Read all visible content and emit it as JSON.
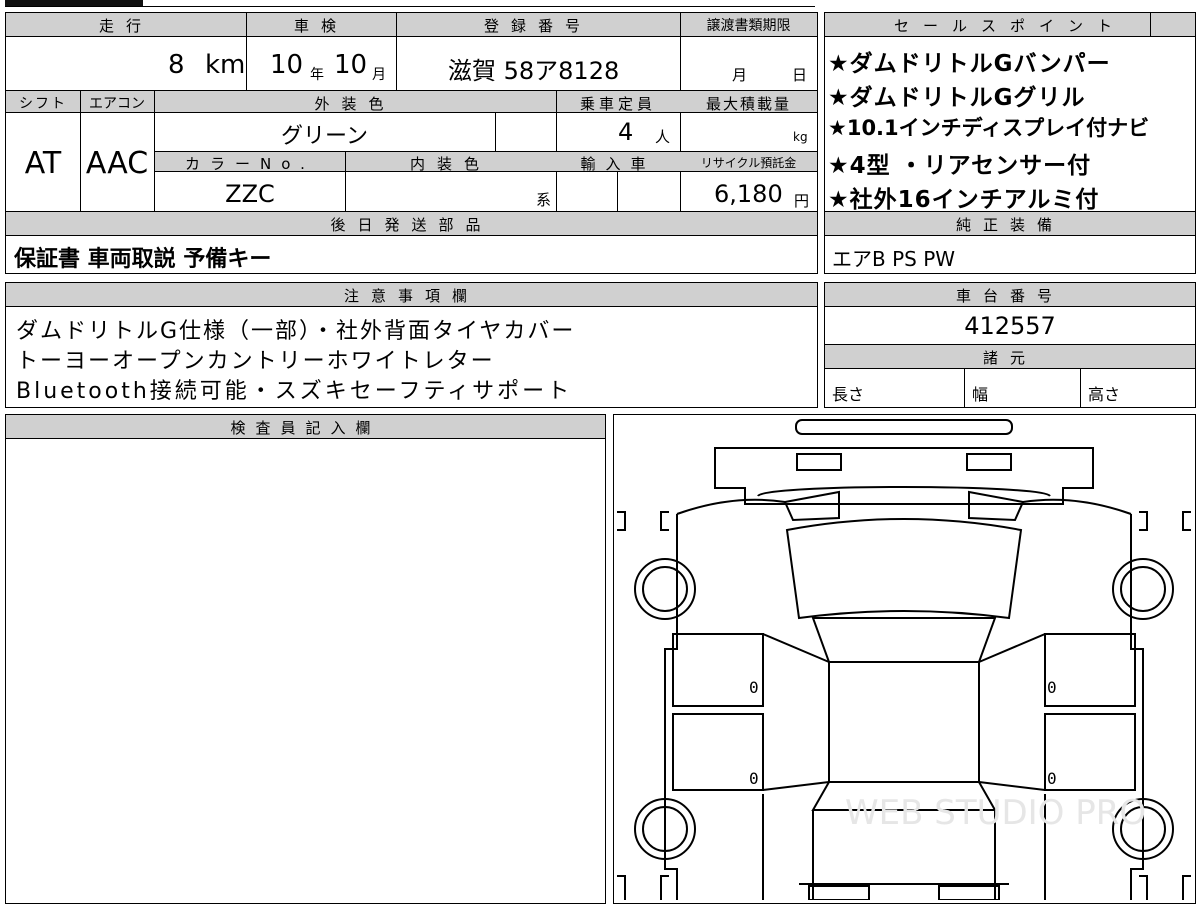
{
  "header": {
    "mileage_label": "走行",
    "inspection_label": "車検",
    "registration_label": "登録番号",
    "transfer_deadline_label": "譲渡書類期限",
    "shift_label": "シフト",
    "aircon_label": "エアコン",
    "exterior_color_label": "外装色",
    "capacity_label": "乗車定員",
    "max_load_label": "最大積載量",
    "color_no_label": "カラーNo.",
    "interior_color_label": "内装色",
    "import_label": "輸入車",
    "recycle_label": "リサイクル預託金",
    "later_parts_label": "後日発送部品",
    "sales_points_label": "セールスポイント",
    "genuine_equip_label": "純正装備"
  },
  "values": {
    "mileage": "8",
    "mileage_unit": "km",
    "inspection_year": "10",
    "year_unit": "年",
    "inspection_month": "10",
    "month_unit": "月",
    "registration": "滋賀 58ア8128",
    "deadline_month_unit": "月",
    "deadline_day_unit": "日",
    "shift": "AT",
    "aircon": "AAC",
    "exterior_color": "グリーン",
    "capacity": "4",
    "capacity_unit": "人",
    "max_load_unit": "kg",
    "color_no": "ZZC",
    "interior_suffix": "系",
    "recycle": "6,180",
    "recycle_unit": "円"
  },
  "later_parts": "保証書 車両取説 予備キー",
  "sales_points": [
    "★ダムドリトルGバンパー",
    "★ダムドリトルGグリル",
    "★10.1インチディスプレイ付ナビ",
    "★4型 ・リアセンサー付",
    "★社外16インチアルミ付"
  ],
  "genuine_equipment": "エアB PS PW",
  "notes": {
    "label": "注意事項欄",
    "lines": [
      "ダムドリトルG仕様（一部）・社外背面タイヤカバー",
      "トーヨーオープンカントリーホワイトレター",
      "Bluetooth接続可能・スズキセーフティサポート"
    ]
  },
  "chassis": {
    "label": "車台番号",
    "number": "412557"
  },
  "specs": {
    "label": "諸元",
    "length": "長さ",
    "width": "幅",
    "height": "高さ"
  },
  "inspector": {
    "label": "検査員記入欄"
  },
  "diagram": {
    "zero_marks": [
      "0",
      "0",
      "0",
      "0"
    ],
    "watermark": "WEB STUDIO PRO"
  }
}
